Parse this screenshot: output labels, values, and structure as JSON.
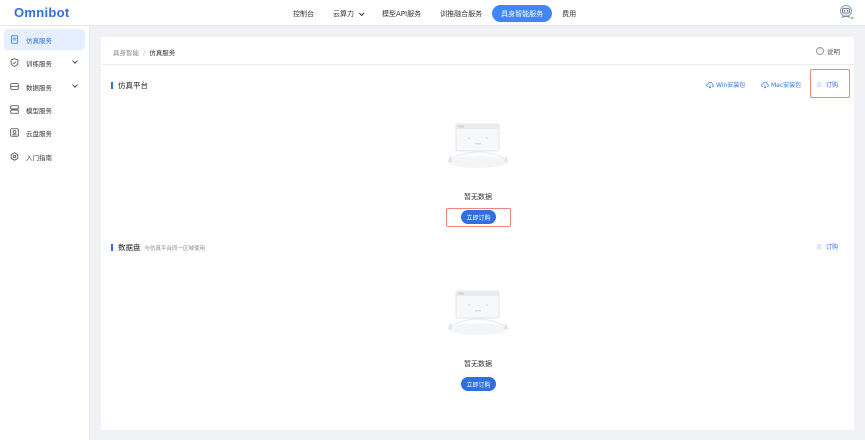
{
  "app": {
    "logo": "Omnibot"
  },
  "nav": {
    "items": [
      {
        "label": "控制台"
      },
      {
        "label": "云算力"
      },
      {
        "label": "模型API服务"
      },
      {
        "label": "训推融合服务"
      },
      {
        "label": "具身智能服务"
      },
      {
        "label": "费用"
      }
    ],
    "active_index": 4
  },
  "sidebar": {
    "items": [
      {
        "label": "仿真服务",
        "icon": "document-icon",
        "active": true
      },
      {
        "label": "训练服务",
        "icon": "shield-icon",
        "expandable": true
      },
      {
        "label": "数据服务",
        "icon": "database-icon",
        "expandable": true
      },
      {
        "label": "模型服务",
        "icon": "server-icon"
      },
      {
        "label": "云盘服务",
        "icon": "cloud-disk-icon"
      },
      {
        "label": "入门指南",
        "icon": "gear-icon"
      }
    ]
  },
  "breadcrumb": {
    "parent": "具身智能",
    "separator": "/",
    "current": "仿真服务"
  },
  "help": {
    "label": "说明"
  },
  "simulation": {
    "title": "仿真平台",
    "win_link": "Win安装包",
    "mac_link": "Mac安装包",
    "subscribe_link": "订购",
    "empty_text": "暂无数据",
    "button": "立即订购"
  },
  "datadisk": {
    "title": "数据盘",
    "subtitle": "与仿真平台同一区域使用",
    "subscribe_link": "订购",
    "empty_text": "暂无数据",
    "button": "立即订购"
  },
  "colors": {
    "accent": "#2f6fe0",
    "active_nav": "#4285f4",
    "highlight_outline": "#f0857e",
    "online": "#52c41a"
  }
}
